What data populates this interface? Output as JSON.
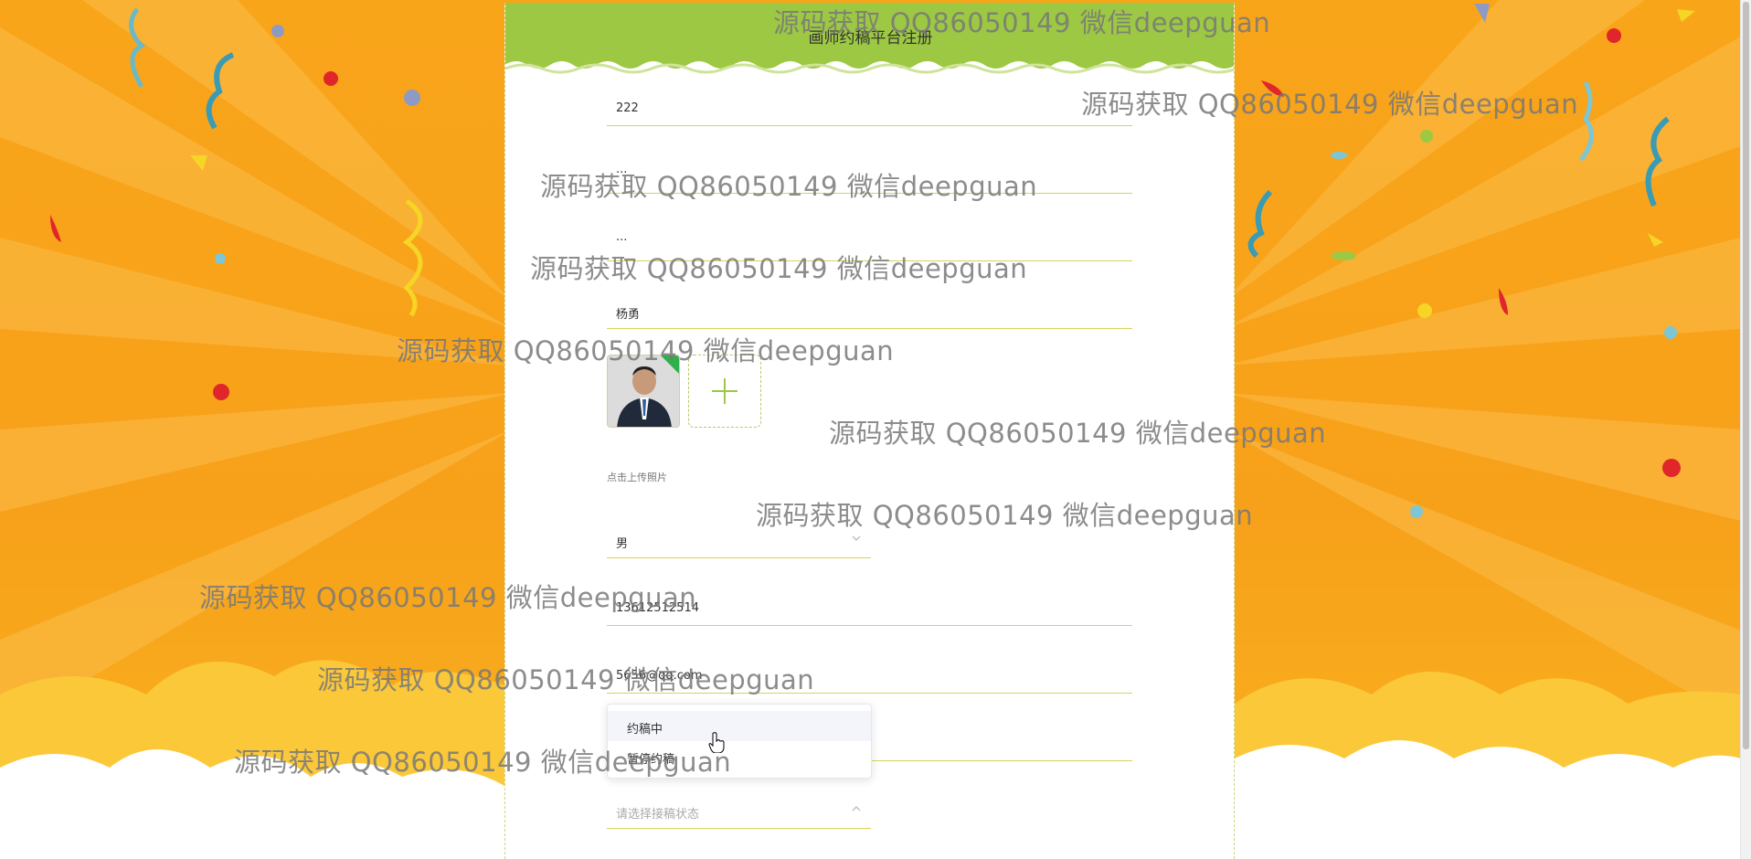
{
  "page": {
    "title": "画师约稿平台注册"
  },
  "form": {
    "account": "222",
    "password": "...",
    "confirm_password": "...",
    "name": "杨勇",
    "upload_hint": "点击上传照片",
    "gender": "男",
    "phone": "13612512514",
    "email": "5656@qq.com",
    "status_placeholder": "请选择接稿状态"
  },
  "status_dropdown": {
    "options": [
      "约稿中",
      "暂停约稿"
    ],
    "hovered_index": 0
  },
  "icons": {
    "upload": "plus-icon",
    "select_caret_down": "chevron-down-icon",
    "select_caret_up": "chevron-up-icon",
    "pointer": "hand-cursor-icon"
  },
  "colors": {
    "header_green": "#9dc843",
    "field_underline": "#d8d35a",
    "background_orange": "#f7a21b"
  },
  "watermark": {
    "text": "源码获取 QQ86050149 微信deepguan"
  }
}
